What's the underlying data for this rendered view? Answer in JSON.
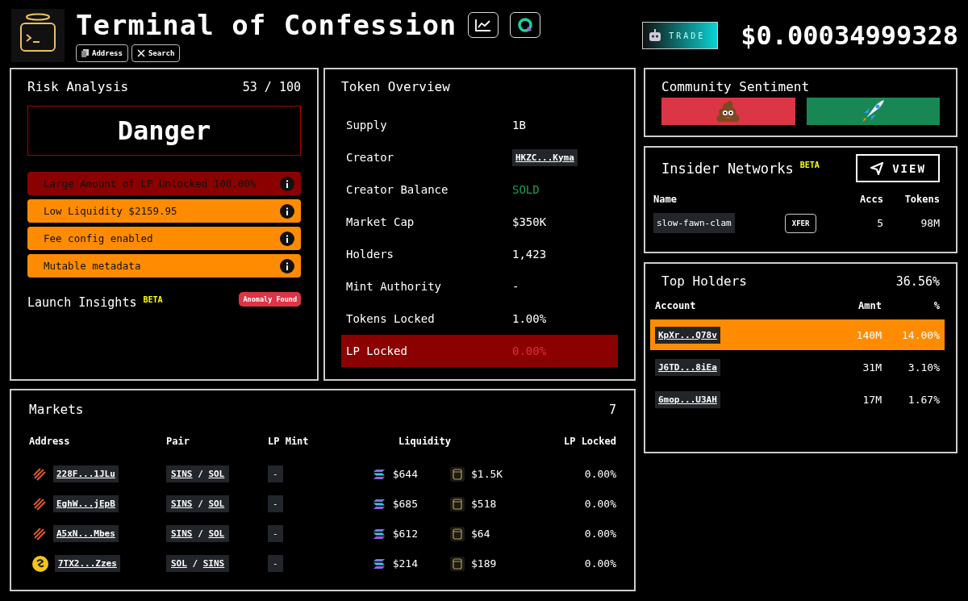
{
  "header": {
    "title": "Terminal of Confession",
    "buttons": [
      {
        "label": "Address",
        "kind": "copy"
      },
      {
        "label": "Search",
        "kind": "x"
      }
    ],
    "trade": "TRADE",
    "price": "$0.00034999328"
  },
  "risk": {
    "title": "Risk Analysis",
    "score": "53 / 100",
    "verdict": "Danger",
    "items": [
      {
        "text": "Large Amount of LP Unlocked 100.00%",
        "kind": "danger"
      },
      {
        "text": "Low Liquidity $2159.95",
        "kind": "warning"
      },
      {
        "text": "Fee config enabled",
        "kind": "warning"
      },
      {
        "text": "Mutable metadata",
        "kind": "warning"
      }
    ],
    "insights": {
      "label": "Launch Insights",
      "tag": "BETA",
      "badge": "Anomaly Found"
    }
  },
  "overview": {
    "title": "Token Overview",
    "rows": [
      {
        "label": "Supply",
        "value": "1B",
        "kind": "text",
        "highlighted": false
      },
      {
        "label": "Creator",
        "value": "HKZC...Kyma",
        "kind": "address",
        "highlighted": false
      },
      {
        "label": "Creator Balance",
        "value": "SOLD",
        "kind": "good",
        "highlighted": false
      },
      {
        "label": "Market Cap",
        "value": "$350K",
        "kind": "text",
        "highlighted": false
      },
      {
        "label": "Holders",
        "value": "1,423",
        "kind": "text",
        "highlighted": false
      },
      {
        "label": "Mint Authority",
        "value": "-",
        "kind": "text",
        "highlighted": false
      },
      {
        "label": "Tokens Locked",
        "value": "1.00%",
        "kind": "text",
        "highlighted": false
      },
      {
        "label": "LP Locked",
        "value": "0.00%",
        "kind": "bad",
        "highlighted": true
      }
    ]
  },
  "sentiment": {
    "title": "Community Sentiment",
    "votes": [
      {
        "kind": "poop",
        "color": "#dc3545"
      },
      {
        "kind": "rocket",
        "color": "#198754"
      }
    ]
  },
  "insiders": {
    "title": "Insider Networks",
    "tag": "BETA",
    "button": "VIEW",
    "columns": [
      "Name",
      "Accs",
      "Tokens"
    ],
    "rows": [
      {
        "name": "slow-fawn-clam",
        "action": "XFER",
        "accs": "5",
        "tokens": "98M"
      }
    ]
  },
  "holders": {
    "title": "Top Holders",
    "total": "36.56%",
    "columns": [
      "Account",
      "Amnt",
      "%"
    ],
    "rows": [
      {
        "account": "KpXr...Q78v",
        "amount": "140M",
        "percent": "14.00%",
        "selected": true
      },
      {
        "account": "J6TD...8iEa",
        "amount": "31M",
        "percent": "3.10%",
        "selected": false
      },
      {
        "account": "6mop...U3AH",
        "amount": "17M",
        "percent": "1.67%",
        "selected": false
      }
    ]
  },
  "markets": {
    "title": "Markets",
    "count": "7",
    "columns": [
      "Address",
      "Pair",
      "LP Mint",
      "Liquidity",
      "LP Locked"
    ],
    "rows": [
      {
        "kind": "stripe",
        "address": "228F...1JLu",
        "base": "SINS",
        "separator": "/",
        "quote": "SOL",
        "lp_mint": "-",
        "liq_sol": "$644",
        "liq_token": "$1.5K",
        "lp_locked": "0.00%"
      },
      {
        "kind": "stripe",
        "address": "EghW...jEpB",
        "base": "SINS",
        "separator": "/",
        "quote": "SOL",
        "lp_mint": "-",
        "liq_sol": "$685",
        "liq_token": "$518",
        "lp_locked": "0.00%"
      },
      {
        "kind": "stripe",
        "address": "A5xN...Mbes",
        "base": "SINS",
        "separator": "/",
        "quote": "SOL",
        "lp_mint": "-",
        "liq_sol": "$612",
        "liq_token": "$64",
        "lp_locked": "0.00%"
      },
      {
        "kind": "coin",
        "address": "7TX2...Zzes",
        "base": "SOL",
        "separator": "/",
        "quote": "SINS",
        "lp_mint": "-",
        "liq_sol": "$214",
        "liq_token": "$189",
        "lp_locked": "0.00%"
      }
    ]
  }
}
